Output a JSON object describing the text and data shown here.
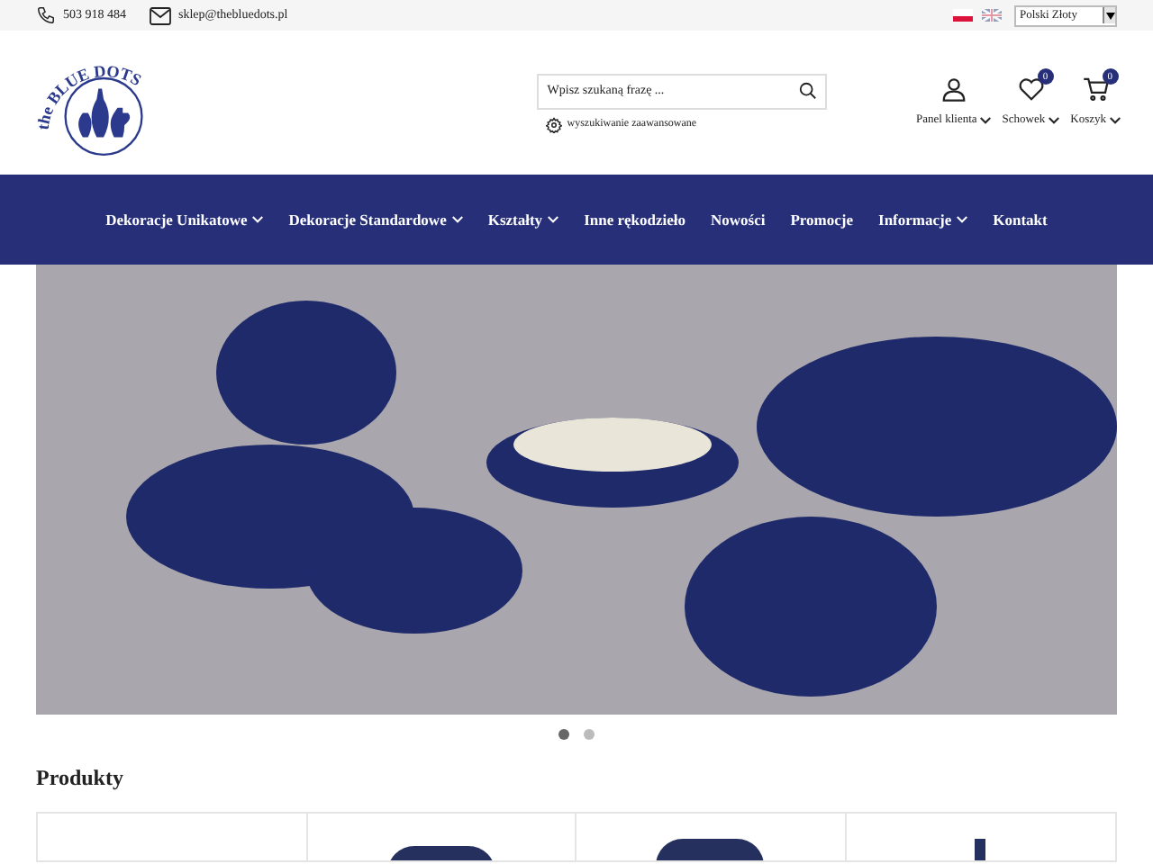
{
  "topbar": {
    "phone": "503 918 484",
    "email": "sklep@thebluedots.pl",
    "languages": [
      {
        "kind": "pl",
        "selected": true
      },
      {
        "kind": "en",
        "selected": false
      }
    ],
    "currency": "Polski Złoty"
  },
  "logo": {
    "top": "the BLUE DOTS"
  },
  "search": {
    "placeholder": "Wpisz szukaną frazę ...",
    "advanced": "wyszukiwanie zaawansowane"
  },
  "actions": [
    {
      "kind": "user",
      "label": "Panel klienta"
    },
    {
      "kind": "heart",
      "label": "Schowek",
      "badge": "0"
    },
    {
      "kind": "cart",
      "label": "Koszyk",
      "badge": "0"
    }
  ],
  "nav": [
    {
      "label": "Dekoracje Unikatowe",
      "dropdown": true
    },
    {
      "label": "Dekoracje Standardowe",
      "dropdown": true
    },
    {
      "label": "Kształty",
      "dropdown": true
    },
    {
      "label": "Inne rękodzieło",
      "dropdown": false
    },
    {
      "label": "Nowości",
      "dropdown": false
    },
    {
      "label": "Promocje",
      "dropdown": false
    },
    {
      "label": "Informacje",
      "dropdown": true
    },
    {
      "label": "Kontakt",
      "dropdown": false
    }
  ],
  "slider": {
    "dots": [
      {
        "selected": true
      },
      {
        "selected": false
      }
    ]
  },
  "section_title": "Produkty"
}
